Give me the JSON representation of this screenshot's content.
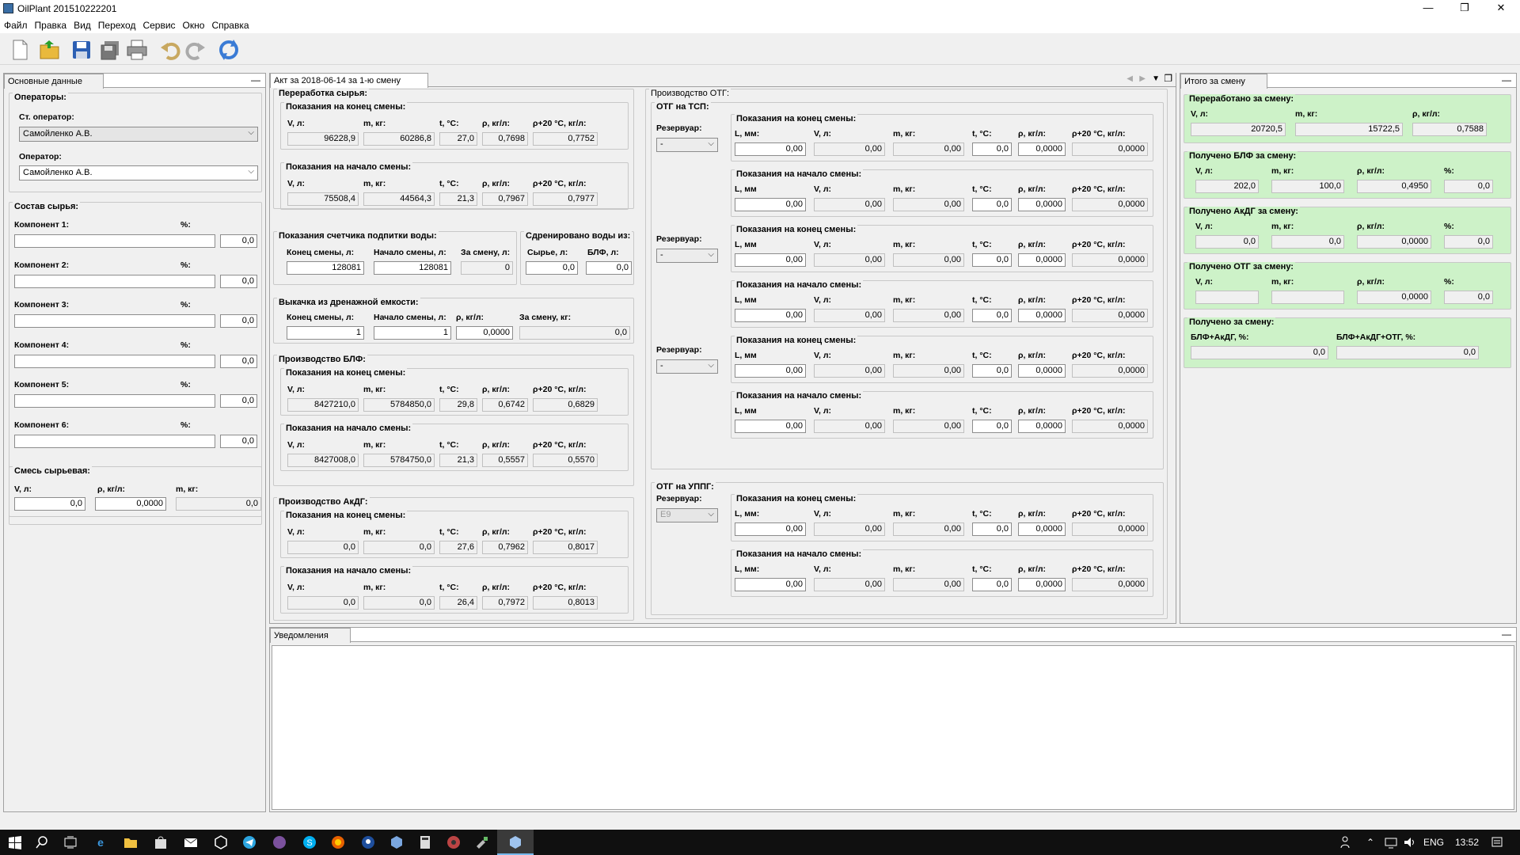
{
  "window": {
    "title": "OilPlant 201510222201",
    "minimize": "—",
    "maximize": "❐",
    "close": "✕"
  },
  "menu": [
    "Файл",
    "Правка",
    "Вид",
    "Переход",
    "Сервис",
    "Окно",
    "Справка"
  ],
  "toolbar": [
    "new-file-icon",
    "open-folder-icon",
    "save-icon",
    "save-all-icon",
    "print-icon",
    "undo-icon",
    "redo-icon",
    "refresh-icon"
  ],
  "left": {
    "tab": "Основные данные",
    "operators": {
      "title": "Операторы:",
      "senior_label": "Ст. оператор:",
      "senior_value": "Самойленко А.В.",
      "operator_label": "Оператор:",
      "operator_value": "Самойленко А.В."
    },
    "composition": {
      "title": "Состав сырья:",
      "pct_label": "%:",
      "components": [
        {
          "label": "Компонент 1:",
          "name": "",
          "pct": "0,0"
        },
        {
          "label": "Компонент 2:",
          "name": "",
          "pct": "0,0"
        },
        {
          "label": "Компонент 3:",
          "name": "",
          "pct": "0,0"
        },
        {
          "label": "Компонент 4:",
          "name": "",
          "pct": "0,0"
        },
        {
          "label": "Компонент 5:",
          "name": "",
          "pct": "0,0"
        },
        {
          "label": "Компонент 6:",
          "name": "",
          "pct": "0,0"
        }
      ]
    },
    "mix": {
      "title": "Смесь сырьевая:",
      "v_label": "V, л:",
      "rho_label": "ρ, кг/л:",
      "m_label": "m, кг:",
      "v": "0,0",
      "rho": "0,0000",
      "m": "0,0"
    }
  },
  "act": {
    "tab": "Акт за 2018-06-14 за 1-ю смену",
    "raw": {
      "title": "Переработка сырья:",
      "end": {
        "title": "Показания на конец смены:",
        "labels": [
          "V, л:",
          "m, кг:",
          "t, °C:",
          "ρ, кг/л:",
          "ρ+20 °C, кг/л:"
        ],
        "values": [
          "96228,9",
          "60286,8",
          "27,0",
          "0,7698",
          "0,7752"
        ]
      },
      "start": {
        "title": "Показания на начало смены:",
        "labels": [
          "V, л:",
          "m, кг:",
          "t, °C:",
          "ρ, кг/л:",
          "ρ+20 °C, кг/л:"
        ],
        "values": [
          "75508,4",
          "44564,3",
          "21,3",
          "0,7967",
          "0,7977"
        ]
      }
    },
    "water": {
      "title": "Показания счетчика подпитки воды:",
      "labels": [
        "Конец смены, л:",
        "Начало смены, л:",
        "За смену, л:"
      ],
      "values": [
        "128081",
        "128081",
        "0"
      ]
    },
    "drained": {
      "title": "Сдренировано воды из:",
      "labels": [
        "Сырье, л:",
        "БЛФ, л:"
      ],
      "values": [
        "0,0",
        "0,0"
      ]
    },
    "drain_tank": {
      "title": "Выкачка из дренажной емкости:",
      "labels": [
        "Конец смены, л:",
        "Начало смены, л:",
        "ρ, кг/л:",
        "За смену, кг:"
      ],
      "values": [
        "1",
        "1",
        "0,0000",
        "0,0"
      ]
    },
    "blf": {
      "title": "Производство БЛФ:",
      "end": {
        "title": "Показания на конец смены:",
        "labels": [
          "V, л:",
          "m, кг:",
          "t, °C:",
          "ρ, кг/л:",
          "ρ+20 °C, кг/л:"
        ],
        "values": [
          "8427210,0",
          "5784850,0",
          "29,8",
          "0,6742",
          "0,6829"
        ]
      },
      "start": {
        "title": "Показания на начало смены:",
        "labels": [
          "V, л:",
          "m, кг:",
          "t, °C:",
          "ρ, кг/л:",
          "ρ+20 °C, кг/л:"
        ],
        "values": [
          "8427008,0",
          "5784750,0",
          "21,3",
          "0,5557",
          "0,5570"
        ]
      }
    },
    "akdg": {
      "title": "Производство АкДГ:",
      "end": {
        "title": "Показания на конец смены:",
        "labels": [
          "V, л:",
          "m, кг:",
          "t, °C:",
          "ρ, кг/л:",
          "ρ+20 °C, кг/л:"
        ],
        "values": [
          "0,0",
          "0,0",
          "27,6",
          "0,7962",
          "0,8017"
        ]
      },
      "start": {
        "title": "Показания на начало смены:",
        "labels": [
          "V, л:",
          "m, кг:",
          "t, °C:",
          "ρ, кг/л:",
          "ρ+20 °C, кг/л:"
        ],
        "values": [
          "0,0",
          "0,0",
          "26,4",
          "0,7972",
          "0,8013"
        ]
      }
    },
    "otg": {
      "title": "Производство ОТГ:",
      "tsp_title": "ОТГ на ТСП:",
      "uppg_title": "ОТГ на УППГ:",
      "reservoir_label": "Резервуар:",
      "end_title": "Показания на конец смены:",
      "start_title": "Показания на начало смены:",
      "labels_a": [
        "L, мм:",
        "V, л:",
        "m, кг:",
        "t, °C:",
        "ρ, кг/л:",
        "ρ+20 °C, кг/л:"
      ],
      "labels_b": [
        "L, мм",
        "V, л:",
        "m, кг:",
        "t, °C:",
        "ρ, кг/л:",
        "ρ+20 °C, кг/л:"
      ],
      "values": [
        "0,00",
        "0,00",
        "0,00",
        "0,0",
        "0,0000",
        "0,0000"
      ],
      "reservoirs": [
        "-",
        "-",
        "-"
      ],
      "uppg_reservoir": "Е9"
    }
  },
  "totals": {
    "tab": "Итого за смену",
    "processed": {
      "title": "Переработано за смену:",
      "labels": [
        "V, л:",
        "m, кг:",
        "ρ, кг/л:"
      ],
      "values": [
        "20720,5",
        "15722,5",
        "0,7588"
      ]
    },
    "blf": {
      "title": "Получено БЛФ за смену:",
      "labels": [
        "V, л:",
        "m, кг:",
        "ρ, кг/л:",
        "%:"
      ],
      "values": [
        "202,0",
        "100,0",
        "0,4950",
        "0,0"
      ]
    },
    "akdg": {
      "title": "Получено АкДГ за смену:",
      "labels": [
        "V, л:",
        "m, кг:",
        "ρ, кг/л:",
        "%:"
      ],
      "values": [
        "0,0",
        "0,0",
        "0,0000",
        "0,0"
      ]
    },
    "otg": {
      "title": "Получено ОТГ за смену:",
      "labels": [
        "V, л:",
        "m, кг:",
        "ρ, кг/л:",
        "%:"
      ],
      "values": [
        "",
        "",
        "0,0000",
        "0,0"
      ]
    },
    "sum": {
      "title": "Получено за смену:",
      "labels": [
        "БЛФ+АкДГ, %:",
        "БЛФ+АкДГ+ОТГ, %:"
      ],
      "values": [
        "0,0",
        "0,0"
      ]
    }
  },
  "notifications": {
    "tab": "Уведомления"
  },
  "taskbar": {
    "lang": "ENG",
    "time": "13:52"
  }
}
